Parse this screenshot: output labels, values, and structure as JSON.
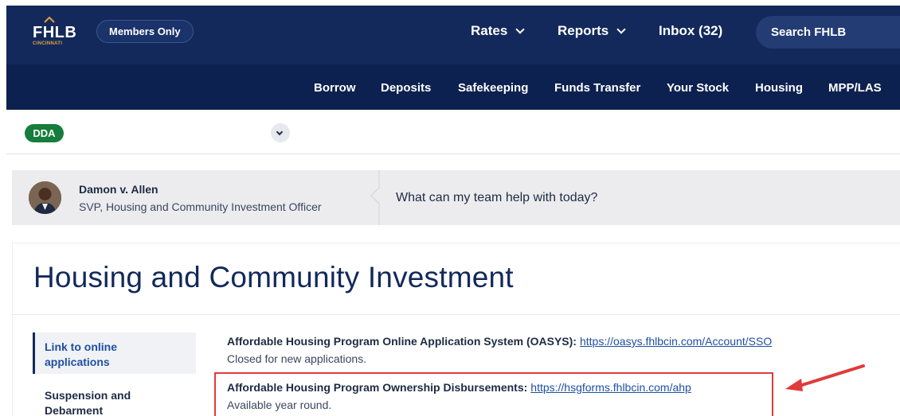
{
  "header": {
    "logo_text": "FHLB",
    "logo_sub": "CINCINNATI",
    "members_label": "Members Only",
    "nav": [
      {
        "label": "Rates"
      },
      {
        "label": "Reports"
      },
      {
        "label": "Inbox (32)"
      }
    ],
    "search_placeholder": "Search FHLB"
  },
  "subnav": [
    "Borrow",
    "Deposits",
    "Safekeeping",
    "Funds Transfer",
    "Your Stock",
    "Housing",
    "MPP/LAS"
  ],
  "account": {
    "badge": "DDA"
  },
  "contact": {
    "name": "Damon v. Allen",
    "title": "SVP, Housing and Community Investment Officer",
    "prompt": "What can my team help with today?"
  },
  "page": {
    "title": "Housing and Community Investment"
  },
  "sidebar": {
    "items": [
      {
        "label_line1": "Link to online",
        "label_line2": "applications"
      },
      {
        "label_line1": "Suspension and",
        "label_line2": "Debarment"
      }
    ]
  },
  "content": {
    "items": [
      {
        "heading": "Affordable Housing Program Online Application System (OASYS):",
        "link": "https://oasys.fhlbcin.com/Account/SSO",
        "note": "Closed for new applications."
      },
      {
        "heading": "Affordable Housing Program Ownership Disbursements:",
        "link": "https://hsgforms.fhlbcin.com/ahp",
        "note": "Available year round."
      }
    ]
  },
  "colors": {
    "header_bg": "#13295b",
    "subnav_bg": "#0d2150",
    "badge_green": "#167d3c",
    "highlight_red": "#e03b3b",
    "link_blue": "#1f4fa3"
  }
}
